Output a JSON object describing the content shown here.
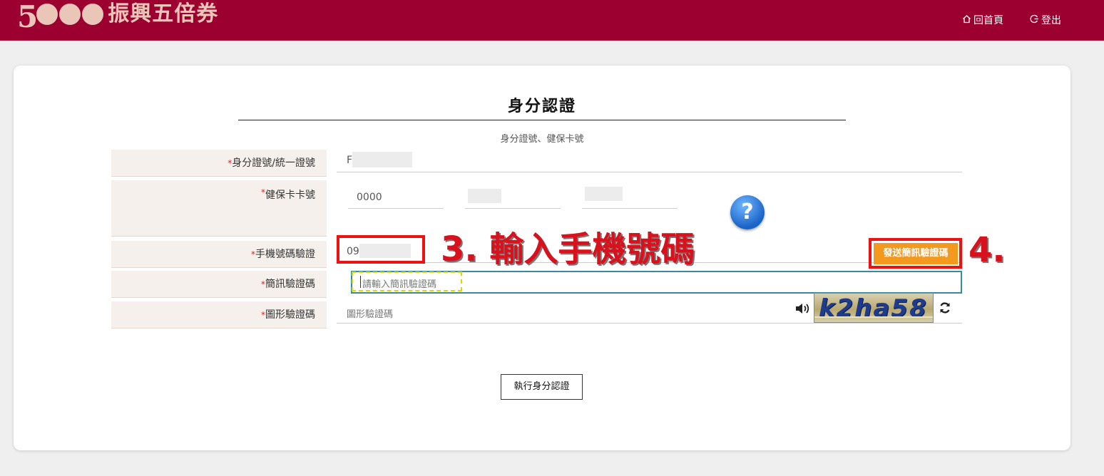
{
  "header": {
    "logo_number": "5",
    "logo_text": "振興五倍券",
    "nav_home_icon": "home-icon",
    "nav_home": "回首頁",
    "nav_logout_icon": "logout-icon",
    "nav_logout": "登出",
    "bg_color": "#9c0030"
  },
  "page": {
    "title": "身分認證",
    "subtitle": "身分證號、健保卡號"
  },
  "form": {
    "id_label": "身分證號/統一證號",
    "id_value": "F",
    "nhi_label": "健保卡卡號",
    "nhi_value_1": "0000",
    "phone_label": "手機號碼驗證",
    "phone_value": "09",
    "sms_label": "簡訊驗證碼",
    "sms_placeholder": "請輸入簡訊驗證碼",
    "captcha_label": "圖形驗證碼",
    "captcha_placeholder": "圖形驗證碼",
    "captcha_image_text": "k2ha58",
    "send_sms_button": "發送簡訊驗證碼",
    "submit_button": "執行身分認證",
    "required_mark": "*",
    "help_icon": "question-icon",
    "help_glyph": "?",
    "audio_icon": "speaker-icon",
    "refresh_icon": "refresh-icon"
  },
  "annotations": {
    "step3": "3. 輸入手機號碼",
    "step4": "4."
  },
  "colors": {
    "accent": "#9c0030",
    "send_button": "#f39a1e",
    "annotation_red": "#d8111c"
  }
}
